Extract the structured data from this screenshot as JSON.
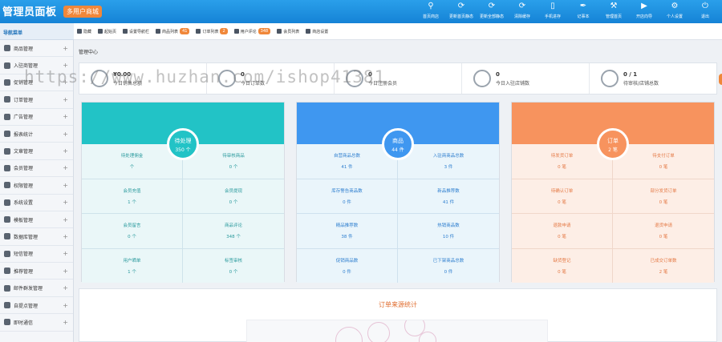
{
  "header": {
    "brand": "管理员面板",
    "badge": "多用户商城",
    "actions": [
      {
        "label": "首页商店",
        "icon": "search-icon"
      },
      {
        "label": "更新首页静态",
        "icon": "refresh-icon"
      },
      {
        "label": "更新全部静态",
        "icon": "refresh-icon"
      },
      {
        "label": "清除缓存",
        "icon": "refresh-icon"
      },
      {
        "label": "手机进存",
        "icon": "phone-icon"
      },
      {
        "label": "记事本",
        "icon": "note-icon"
      },
      {
        "label": "管理首页",
        "icon": "tools-icon"
      },
      {
        "label": "开店向导",
        "icon": "play-icon"
      },
      {
        "label": "个人设置",
        "icon": "gear-icon"
      },
      {
        "label": "退出",
        "icon": "power-icon"
      }
    ]
  },
  "nav": {
    "title": "导航菜单",
    "items": [
      {
        "label": "商品管理"
      },
      {
        "label": "入驻商管理"
      },
      {
        "label": "促销管理"
      },
      {
        "label": "订单管理"
      },
      {
        "label": "广告管理"
      },
      {
        "label": "报表统计"
      },
      {
        "label": "文章管理"
      },
      {
        "label": "会员管理"
      },
      {
        "label": "权限管理"
      },
      {
        "label": "系统设置"
      },
      {
        "label": "模板管理"
      },
      {
        "label": "数据库管理"
      },
      {
        "label": "短信管理"
      },
      {
        "label": "推荐管理"
      },
      {
        "label": "邮件群发管理"
      },
      {
        "label": "自提点管理"
      },
      {
        "label": "即时通信"
      }
    ]
  },
  "toolbar": {
    "items": [
      {
        "label": "隐藏"
      },
      {
        "label": "起始页"
      },
      {
        "label": "设置导航栏"
      },
      {
        "label": "商品列表",
        "badge": "41"
      },
      {
        "label": "订单列表",
        "badge": "2"
      },
      {
        "label": "用户评论",
        "badge": "348"
      },
      {
        "label": "会员列表"
      },
      {
        "label": "商店设置"
      }
    ]
  },
  "breadcrumb": "管理中心",
  "stats": [
    {
      "value": "¥0.00",
      "label": "今日销售总额"
    },
    {
      "value": "0",
      "label": "今日订单数"
    },
    {
      "value": "0",
      "label": "今日注册会员"
    },
    {
      "value": "0",
      "label": "今日入驻店铺数"
    },
    {
      "value": "0 / 1",
      "label": "待审核/店铺总数"
    }
  ],
  "cards": [
    {
      "title": "待处理",
      "value": "350 个",
      "cells": [
        {
          "label": "待处理佣金",
          "value": "个"
        },
        {
          "label": "待审核商品",
          "value": "0 个"
        },
        {
          "label": "会员充值",
          "value": "1 个"
        },
        {
          "label": "会员提现",
          "value": "0 个"
        },
        {
          "label": "会员留言",
          "value": "0 个"
        },
        {
          "label": "商品评论",
          "value": "348 个"
        },
        {
          "label": "用户晒单",
          "value": "1 个"
        },
        {
          "label": "标签审核",
          "value": "0 个"
        }
      ]
    },
    {
      "title": "商品",
      "value": "44 件",
      "cells": [
        {
          "label": "自营商品总数",
          "value": "41 件"
        },
        {
          "label": "入驻商商品总数",
          "value": "3 件"
        },
        {
          "label": "库存警告商品数",
          "value": "0 件"
        },
        {
          "label": "新品推荐数",
          "value": "41 件"
        },
        {
          "label": "精品推荐数",
          "value": "38 件"
        },
        {
          "label": "热销商品数",
          "value": "10 件"
        },
        {
          "label": "促销商品数",
          "value": "0 件"
        },
        {
          "label": "已下架商品总数",
          "value": "0 件"
        }
      ]
    },
    {
      "title": "订单",
      "value": "2 笔",
      "cells": [
        {
          "label": "待发货订单",
          "value": "0 笔"
        },
        {
          "label": "待支付订单",
          "value": "0 笔"
        },
        {
          "label": "待确认订单",
          "value": "0 笔"
        },
        {
          "label": "部分发货订单",
          "value": "0 笔"
        },
        {
          "label": "退款申请",
          "value": "0 笔"
        },
        {
          "label": "退货申请",
          "value": "0 笔"
        },
        {
          "label": "缺货登记",
          "value": "0 笔"
        },
        {
          "label": "已成交订单数",
          "value": "2 笔"
        }
      ]
    }
  ],
  "order_section": {
    "title": "订单来源统计"
  },
  "watermark": "https://www.huzhan.com/ishop41381"
}
